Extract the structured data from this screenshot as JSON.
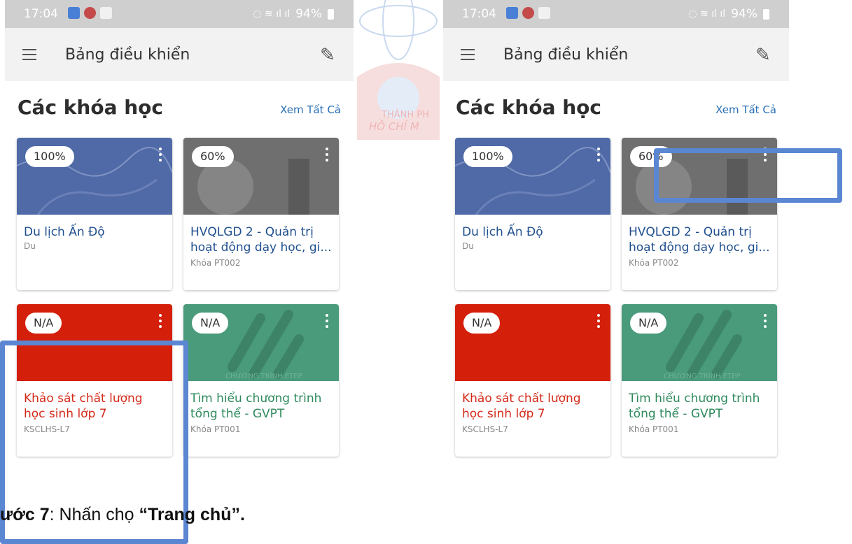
{
  "status_bar": {
    "time": "17:04",
    "battery": "94%"
  },
  "app_bar": {
    "title": "Bảng điều khiển"
  },
  "section": {
    "title": "Các khóa học",
    "see_all": "Xem Tất Cả"
  },
  "watermark": {
    "lines": [
      "THÀNH PH",
      "HỒ CHÍ M"
    ]
  },
  "courses": [
    {
      "progress": "100%",
      "title": "Du lịch Ấn Độ",
      "code": "Du",
      "title_color": "#1f4f8f",
      "thumb_color": "#4f6aa6"
    },
    {
      "progress": "60%",
      "title": "HVQLGD 2 - Quản trị hoạt động dạy học, gi...",
      "code": "Khóa PT002",
      "title_color": "#1f4f8f",
      "thumb_color": "#6f6f6f"
    },
    {
      "progress": "N/A",
      "title": "Khảo sát chất lượng học sinh lớp 7",
      "code": "KSCLHS-L7",
      "title_color": "#d42a1a",
      "thumb_color": "#d41f0b"
    },
    {
      "progress": "N/A",
      "title": "Tìm hiểu chương trình tổng thể - GVPT",
      "code": "Khóa PT001",
      "title_color": "#2e8a5c",
      "thumb_color": "#4a9a7c",
      "thumb_text": "CHƯƠNG TRÌNH ETEP"
    }
  ],
  "caption": {
    "prefix": "ước 7",
    "middle": ": Nhấn chọ",
    "bold": "“Trang chủ”."
  },
  "colors": {
    "highlight": "#5b86d2",
    "link": "#2a6fb5"
  }
}
